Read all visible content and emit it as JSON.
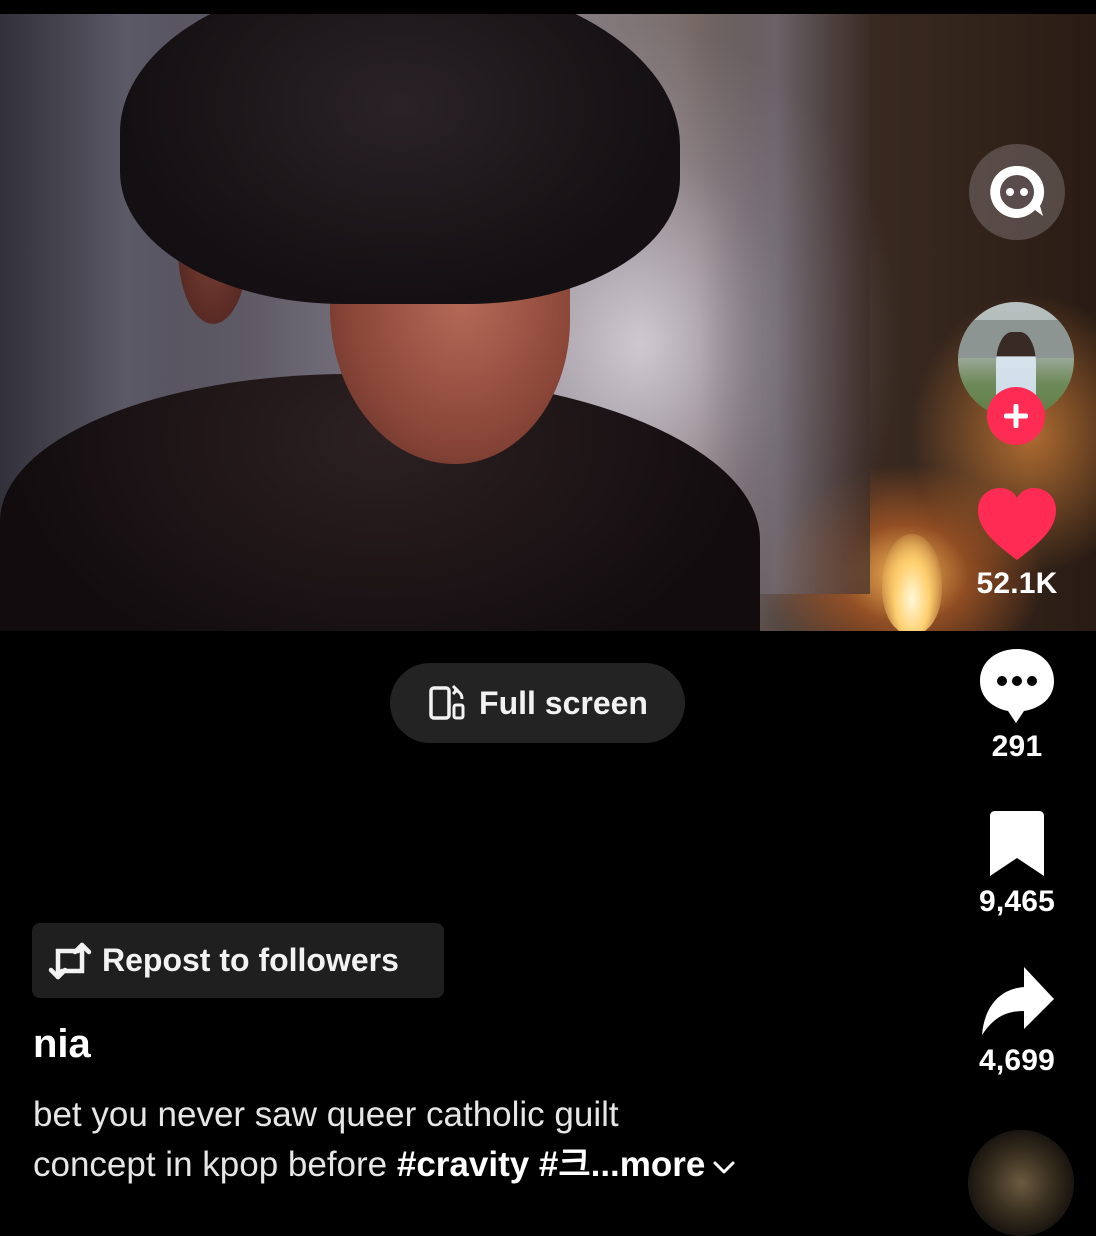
{
  "video": {
    "description_icon": "video-frame"
  },
  "actions": {
    "assistant_icon": "chat-bubble-face-icon",
    "follow_icon": "plus-icon",
    "likes": "52.1K",
    "comments": "291",
    "saves": "9,465",
    "shares": "4,699",
    "like_color": "#fe2c55"
  },
  "fullscreen": {
    "label": "Full screen"
  },
  "repost": {
    "label": "Repost to followers"
  },
  "post": {
    "username": "nia",
    "caption_line1": "bet you never saw queer catholic guilt",
    "caption_line2": "concept in kpop before ",
    "tag1": "#cravity",
    "tag2": " #크",
    "more": "...more"
  }
}
